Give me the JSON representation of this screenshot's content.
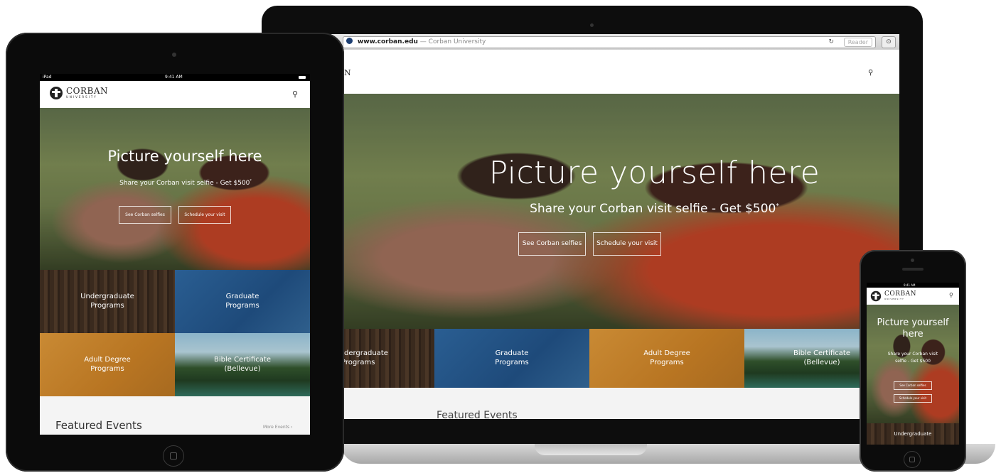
{
  "browser": {
    "url_domain": "www.corban.edu",
    "url_title": "— Corban University",
    "reader_label": "Reader"
  },
  "site": {
    "logo_word": "CORBAN",
    "logo_sub": "UNIVERSITY",
    "laptop_logo_fragment": "N",
    "search_icon": "🔍"
  },
  "hero": {
    "title": "Picture yourself here",
    "subtitle": "Share your Corban visit selfie - Get $500",
    "subtitle_mark": "*",
    "buttons": [
      "See Corban selfies",
      "Schedule your visit"
    ]
  },
  "phone_hero": {
    "title_line1": "Picture yourself",
    "title_line2": "here",
    "subtitle_line1": "Share your Corban visit",
    "subtitle_line2": "selfie - Get $500",
    "button1": "See Corban selfies",
    "button2": "Schedule your visit"
  },
  "programs": [
    {
      "line1": "Undergraduate",
      "line2": "Programs"
    },
    {
      "line1": "Graduate",
      "line2": "Programs"
    },
    {
      "line1": "Adult Degree",
      "line2": "Programs"
    },
    {
      "line1": "Bible Certificate",
      "line2": "(Bellevue)"
    }
  ],
  "laptop_program_fragment": "dergraduate",
  "featured": {
    "title": "Featured Events",
    "more": "More Events ›"
  },
  "ipad_status": {
    "carrier": "iPad",
    "time": "9:41 AM"
  },
  "iphone_status": {
    "time": "9:41 AM"
  },
  "phone_program": "Undergraduate"
}
